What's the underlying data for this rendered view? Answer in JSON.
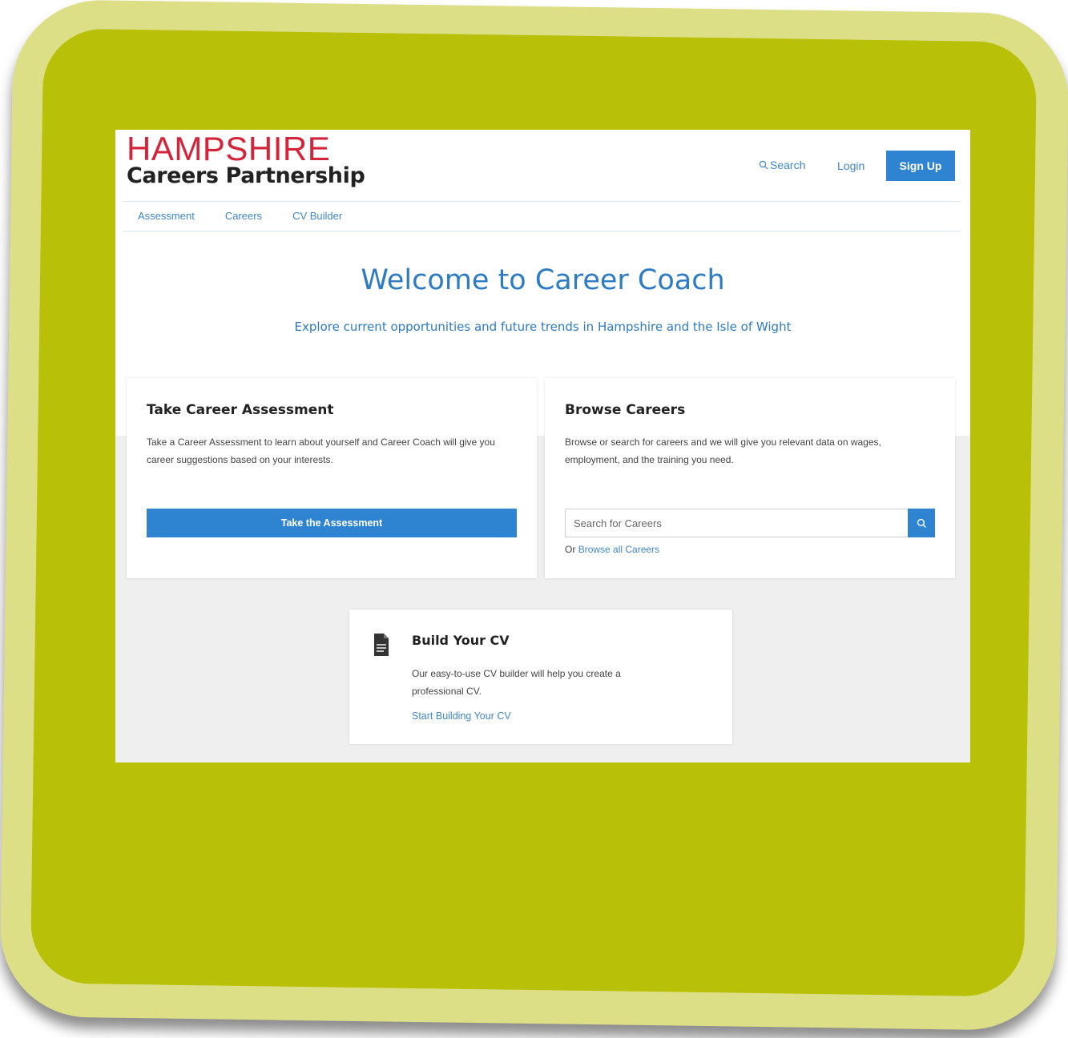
{
  "header": {
    "logo_top": "HAMPSHIRE",
    "logo_bottom": "Careers Partnership",
    "search_label": "Search",
    "login_label": "Login",
    "signup_label": "Sign Up"
  },
  "nav": {
    "items": [
      "Assessment",
      "Careers",
      "CV Builder"
    ]
  },
  "hero": {
    "title": "Welcome to Career Coach",
    "subtitle": "Explore current opportunities and future trends in Hampshire and the Isle of Wight"
  },
  "assessment_card": {
    "title": "Take Career Assessment",
    "text": "Take a Career Assessment to learn about yourself and Career Coach will give you career suggestions based on your interests.",
    "button": "Take the Assessment"
  },
  "browse_card": {
    "title": "Browse Careers",
    "text": "Browse or search for careers and we will give you relevant data on wages, employment, and the training you need.",
    "search_placeholder": "Search for Careers",
    "or_prefix": "Or",
    "browse_all_link": "Browse all Careers"
  },
  "cv_card": {
    "title": "Build Your CV",
    "text": "Our easy-to-use CV builder will help you create a professional CV.",
    "link": "Start Building Your CV"
  },
  "colors": {
    "frame_outer": "#dcdf86",
    "frame_inner": "#b8c108",
    "brand_red": "#d4243a",
    "accent_blue": "#2e84d0"
  }
}
